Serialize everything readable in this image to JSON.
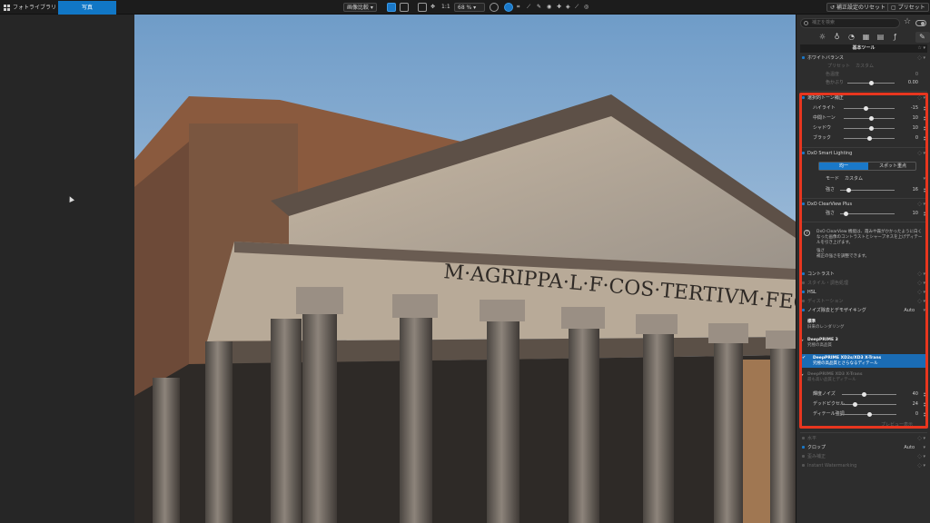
{
  "topbar": {
    "library_tab": "フォトライブラリ",
    "customize_tab": "写真",
    "compare_label": "画像比較",
    "zoom_fit": "1:1",
    "zoom_level": "68 %",
    "reset_label": "補正設定のリセット",
    "preset_label": "プリセット"
  },
  "panel": {
    "search_placeholder": "補正を検索",
    "section_title": "基本ツール",
    "white_balance": "ホワイトバランス",
    "wb_preset_label": "プリセット",
    "wb_preset_value": "カスタム",
    "wb_temp_label": "色温度",
    "wb_temp_value": "0",
    "wb_tint_label": "色かぶり",
    "wb_tint_value": "0.00",
    "tone": {
      "title": "選択的トーン補正",
      "sliders": [
        {
          "label": "ハイライト",
          "value": "-15",
          "pos": 0.44
        },
        {
          "label": "中間トーン",
          "value": "10",
          "pos": 0.55
        },
        {
          "label": "シャドウ",
          "value": "10",
          "pos": 0.55
        },
        {
          "label": "ブラック",
          "value": "0",
          "pos": 0.5
        }
      ]
    },
    "smart_lighting": {
      "title": "DxO Smart Lighting",
      "seg_a": "均一",
      "seg_b": "スポット重点",
      "mode_label": "モード",
      "mode_value": "カスタム",
      "strength_label": "強さ",
      "strength_value": "16",
      "strength_pos": 0.16
    },
    "clearview": {
      "title": "DxO ClearView Plus",
      "strength_label": "強さ",
      "strength_value": "10",
      "strength_pos": 0.1
    },
    "info": {
      "mark": "?",
      "line1": "DxO ClearView 機能は、霞みや霧がかかったように白くなった画像のコントラストとシャープネスを上げディテールを引き上げます。",
      "line2": "強さ",
      "line3": "補正の強さを調整できます。"
    },
    "contrast": "コントラスト",
    "color_profile": "スタイル・調色処理",
    "hsl": "HSL",
    "chroma": "ディストーション",
    "noise": {
      "title": "ノイズ除去とデモザイキング",
      "auto": "Auto",
      "options": [
        {
          "title": "標準",
          "sub": "旧来のレンダリング"
        },
        {
          "title": "DeepPRIME 3",
          "sub": "究極の高品質"
        },
        {
          "title": "DeepPRIME XD2s/XD3 X-Trans",
          "sub": "究極の高品質とさらなるディテール"
        },
        {
          "title": "DeepPRIME XD3 X-Trans",
          "sub": "最も高い品質とディテール"
        }
      ],
      "sliders": [
        {
          "label": "輝度ノイズ",
          "value": "40",
          "pos": 0.4
        },
        {
          "label": "デッドピクセル",
          "value": "24",
          "pos": 0.24
        },
        {
          "label": "ディテール強調",
          "value": "0",
          "pos": 0.5
        }
      ],
      "preview_label": "プレビュー表示"
    },
    "horizon": "水平",
    "crop": "クロップ",
    "crop_auto": "Auto",
    "distortion": "歪み補正",
    "watermark": "Instant Watermarking"
  },
  "photo": {
    "inscription": "M·AGRIPPA·L·F·COS·TERTIVM·FECIT"
  }
}
